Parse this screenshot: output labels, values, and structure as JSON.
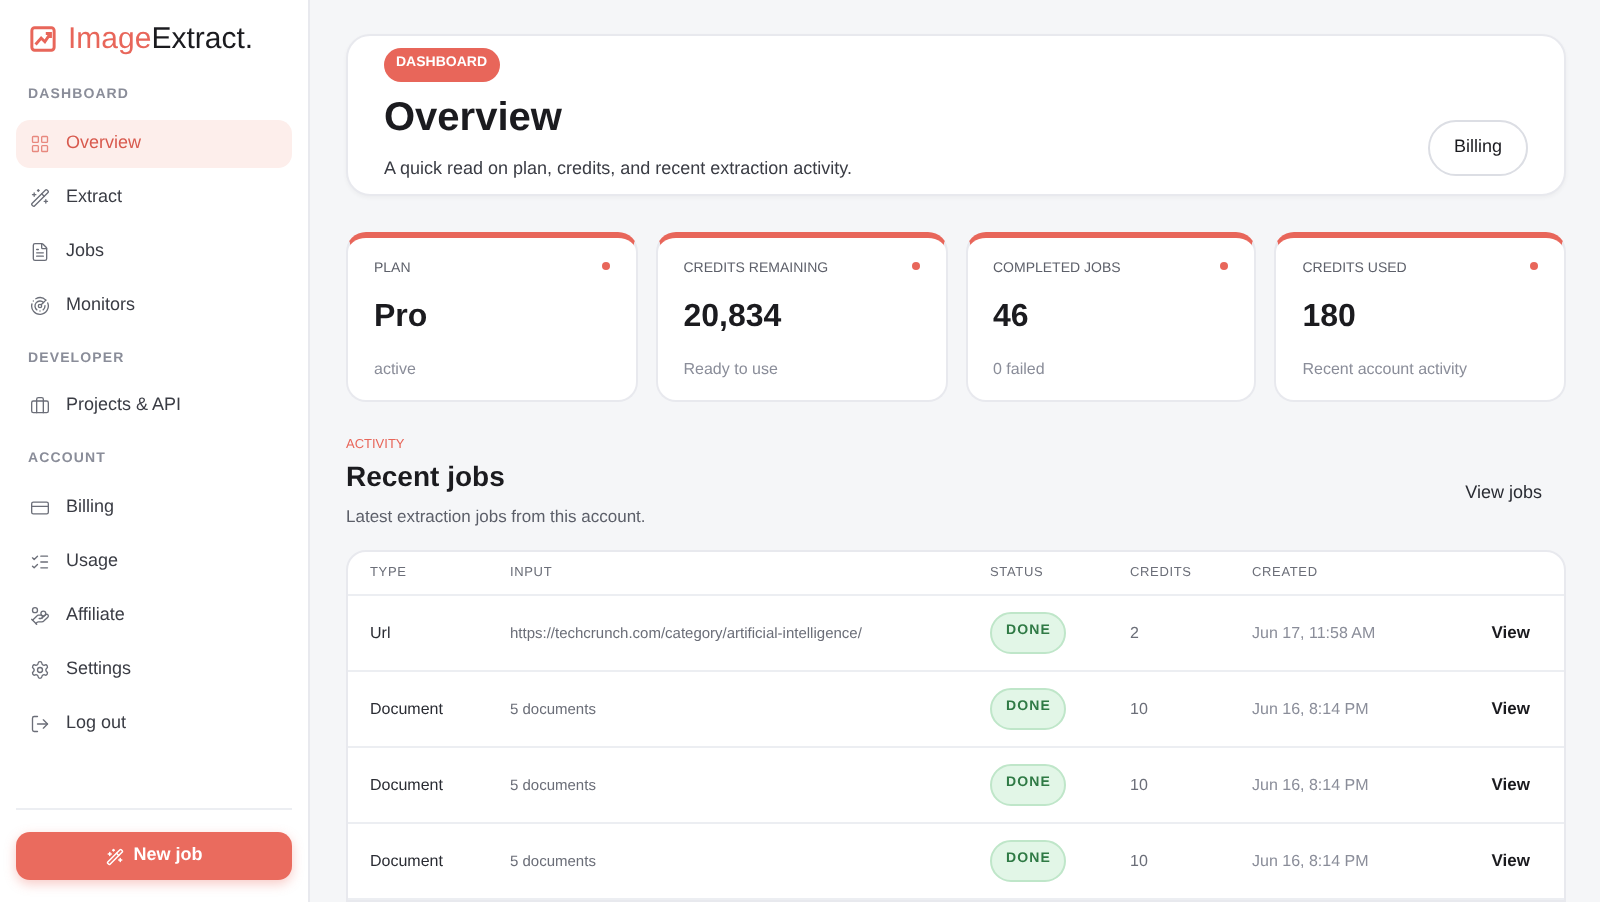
{
  "brand": {
    "first": "Image",
    "second": "Extract."
  },
  "sidebar": {
    "sections": [
      {
        "heading": "DASHBOARD",
        "items": [
          {
            "label": "Overview",
            "selected": true
          },
          {
            "label": "Extract",
            "selected": false
          },
          {
            "label": "Jobs",
            "selected": false
          },
          {
            "label": "Monitors",
            "selected": false
          }
        ]
      },
      {
        "heading": "DEVELOPER",
        "items": [
          {
            "label": "Projects & API",
            "selected": false
          }
        ]
      },
      {
        "heading": "ACCOUNT",
        "items": [
          {
            "label": "Billing",
            "selected": false
          },
          {
            "label": "Usage",
            "selected": false
          },
          {
            "label": "Affiliate",
            "selected": false
          },
          {
            "label": "Settings",
            "selected": false
          },
          {
            "label": "Log out",
            "selected": false
          }
        ]
      }
    ],
    "new_job_button": "New job"
  },
  "header": {
    "badge": "DASHBOARD",
    "title": "Overview",
    "subtitle": "A quick read on plan, credits, and recent extraction activity.",
    "button": "Billing"
  },
  "stats": [
    {
      "label": "PLAN",
      "value": "Pro",
      "note": "active"
    },
    {
      "label": "CREDITS REMAINING",
      "value": "20,834",
      "note": "Ready to use"
    },
    {
      "label": "COMPLETED JOBS",
      "value": "46",
      "note": "0 failed"
    },
    {
      "label": "CREDITS USED",
      "value": "180",
      "note": "Recent account activity"
    }
  ],
  "activity": {
    "eyebrow": "ACTIVITY",
    "title": "Recent jobs",
    "subtitle": "Latest extraction jobs from this account.",
    "link": "View jobs"
  },
  "table": {
    "columns": [
      "TYPE",
      "INPUT",
      "STATUS",
      "CREDITS",
      "CREATED"
    ],
    "rows": [
      {
        "type": "Url",
        "input": "https://techcrunch.com/category/artificial-intelligence/",
        "status": "DONE",
        "credits": "2",
        "created": "Jun 17, 11:58 AM",
        "action": "View"
      },
      {
        "type": "Document",
        "input": "5 documents",
        "status": "DONE",
        "credits": "10",
        "created": "Jun 16, 8:14 PM",
        "action": "View"
      },
      {
        "type": "Document",
        "input": "5 documents",
        "status": "DONE",
        "credits": "10",
        "created": "Jun 16, 8:14 PM",
        "action": "View"
      },
      {
        "type": "Document",
        "input": "5 documents",
        "status": "DONE",
        "credits": "10",
        "created": "Jun 16, 8:14 PM",
        "action": "View"
      }
    ]
  }
}
